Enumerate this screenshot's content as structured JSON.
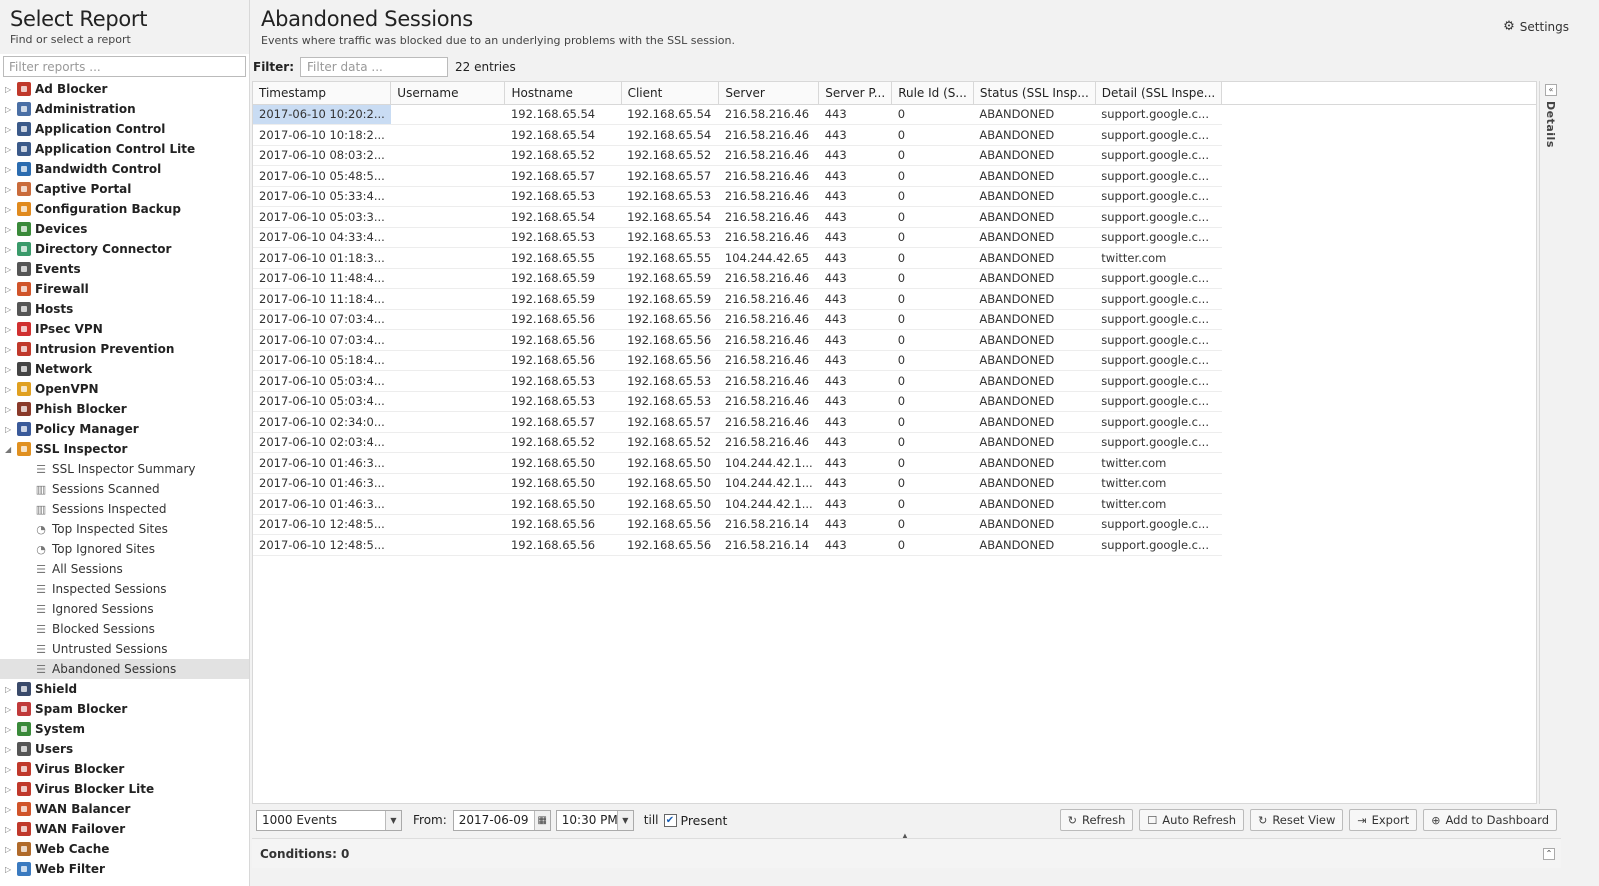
{
  "left_panel": {
    "title": "Select Report",
    "subtitle": "Find or select a report",
    "filter_placeholder": "Filter reports ...",
    "tree": [
      {
        "label": "Ad Blocker",
        "icon": "ad-blocker-icon",
        "color": "#c0392b"
      },
      {
        "label": "Administration",
        "icon": "administration-icon",
        "color": "#4a6fa5"
      },
      {
        "label": "Application Control",
        "icon": "application-control-icon",
        "color": "#3b5a8a"
      },
      {
        "label": "Application Control Lite",
        "icon": "application-control-lite-icon",
        "color": "#3b5a8a"
      },
      {
        "label": "Bandwidth Control",
        "icon": "bandwidth-control-icon",
        "color": "#2b6cb0"
      },
      {
        "label": "Captive Portal",
        "icon": "captive-portal-icon",
        "color": "#c96b3b"
      },
      {
        "label": "Configuration Backup",
        "icon": "configuration-backup-icon",
        "color": "#e08a1e"
      },
      {
        "label": "Devices",
        "icon": "devices-icon",
        "color": "#3a8a3a"
      },
      {
        "label": "Directory Connector",
        "icon": "directory-connector-icon",
        "color": "#3a9a6a"
      },
      {
        "label": "Events",
        "icon": "events-icon",
        "color": "#555555"
      },
      {
        "label": "Firewall",
        "icon": "firewall-icon",
        "color": "#d0542a"
      },
      {
        "label": "Hosts",
        "icon": "hosts-icon",
        "color": "#555555"
      },
      {
        "label": "IPsec VPN",
        "icon": "ipsec-vpn-icon",
        "color": "#d03030"
      },
      {
        "label": "Intrusion Prevention",
        "icon": "intrusion-prevention-icon",
        "color": "#c0392b"
      },
      {
        "label": "Network",
        "icon": "network-icon",
        "color": "#444444"
      },
      {
        "label": "OpenVPN",
        "icon": "openvpn-icon",
        "color": "#e0a020"
      },
      {
        "label": "Phish Blocker",
        "icon": "phish-blocker-icon",
        "color": "#8a3a2a"
      },
      {
        "label": "Policy Manager",
        "icon": "policy-manager-icon",
        "color": "#3a5a9a"
      },
      {
        "label": "SSL Inspector",
        "icon": "ssl-inspector-icon",
        "color": "#e09020",
        "expanded": true,
        "children": [
          {
            "label": "SSL Inspector Summary",
            "icon": "text-lines-icon",
            "glyph": "☰"
          },
          {
            "label": "Sessions Scanned",
            "icon": "bar-chart-icon",
            "glyph": "▥"
          },
          {
            "label": "Sessions Inspected",
            "icon": "bar-chart-icon",
            "glyph": "▥"
          },
          {
            "label": "Top Inspected Sites",
            "icon": "pie-chart-icon",
            "glyph": "◔"
          },
          {
            "label": "Top Ignored Sites",
            "icon": "pie-chart-icon",
            "glyph": "◔"
          },
          {
            "label": "All Sessions",
            "icon": "list-icon",
            "glyph": "☰"
          },
          {
            "label": "Inspected Sessions",
            "icon": "list-icon",
            "glyph": "☰"
          },
          {
            "label": "Ignored Sessions",
            "icon": "list-icon",
            "glyph": "☰"
          },
          {
            "label": "Blocked Sessions",
            "icon": "list-icon",
            "glyph": "☰"
          },
          {
            "label": "Untrusted Sessions",
            "icon": "list-icon",
            "glyph": "☰"
          },
          {
            "label": "Abandoned Sessions",
            "icon": "list-icon",
            "glyph": "☰",
            "selected": true
          }
        ]
      },
      {
        "label": "Shield",
        "icon": "shield-icon",
        "color": "#3a4a6a"
      },
      {
        "label": "Spam Blocker",
        "icon": "spam-blocker-icon",
        "color": "#c03a3a"
      },
      {
        "label": "System",
        "icon": "system-icon",
        "color": "#3a8a3a"
      },
      {
        "label": "Users",
        "icon": "users-icon",
        "color": "#555555"
      },
      {
        "label": "Virus Blocker",
        "icon": "virus-blocker-icon",
        "color": "#c0392b"
      },
      {
        "label": "Virus Blocker Lite",
        "icon": "virus-blocker-lite-icon",
        "color": "#c0392b"
      },
      {
        "label": "WAN Balancer",
        "icon": "wan-balancer-icon",
        "color": "#d0542a"
      },
      {
        "label": "WAN Failover",
        "icon": "wan-failover-icon",
        "color": "#c0392b"
      },
      {
        "label": "Web Cache",
        "icon": "web-cache-icon",
        "color": "#b06a2a"
      },
      {
        "label": "Web Filter",
        "icon": "web-filter-icon",
        "color": "#3a7ac0"
      }
    ]
  },
  "header": {
    "title": "Abandoned Sessions",
    "subtitle": "Events where traffic was blocked due to an underlying problems with the SSL session.",
    "settings_label": "Settings"
  },
  "filter": {
    "label": "Filter:",
    "placeholder": "Filter data ...",
    "entries": "22 entries"
  },
  "table": {
    "columns": [
      "Timestamp",
      "Username",
      "Hostname",
      "Client",
      "Server",
      "Server P...",
      "Rule Id (S...",
      "Status (SSL Insp...",
      "Detail (SSL Inspe..."
    ],
    "rows": [
      [
        "2017-06-10 10:20:2...",
        "",
        "192.168.65.54",
        "192.168.65.54",
        "216.58.216.46",
        "443",
        "0",
        "ABANDONED",
        "support.google.c..."
      ],
      [
        "2017-06-10 10:18:2...",
        "",
        "192.168.65.54",
        "192.168.65.54",
        "216.58.216.46",
        "443",
        "0",
        "ABANDONED",
        "support.google.c..."
      ],
      [
        "2017-06-10 08:03:2...",
        "",
        "192.168.65.52",
        "192.168.65.52",
        "216.58.216.46",
        "443",
        "0",
        "ABANDONED",
        "support.google.c..."
      ],
      [
        "2017-06-10 05:48:5...",
        "",
        "192.168.65.57",
        "192.168.65.57",
        "216.58.216.46",
        "443",
        "0",
        "ABANDONED",
        "support.google.c..."
      ],
      [
        "2017-06-10 05:33:4...",
        "",
        "192.168.65.53",
        "192.168.65.53",
        "216.58.216.46",
        "443",
        "0",
        "ABANDONED",
        "support.google.c..."
      ],
      [
        "2017-06-10 05:03:3...",
        "",
        "192.168.65.54",
        "192.168.65.54",
        "216.58.216.46",
        "443",
        "0",
        "ABANDONED",
        "support.google.c..."
      ],
      [
        "2017-06-10 04:33:4...",
        "",
        "192.168.65.53",
        "192.168.65.53",
        "216.58.216.46",
        "443",
        "0",
        "ABANDONED",
        "support.google.c..."
      ],
      [
        "2017-06-10 01:18:3...",
        "",
        "192.168.65.55",
        "192.168.65.55",
        "104.244.42.65",
        "443",
        "0",
        "ABANDONED",
        "twitter.com"
      ],
      [
        "2017-06-10 11:48:4...",
        "",
        "192.168.65.59",
        "192.168.65.59",
        "216.58.216.46",
        "443",
        "0",
        "ABANDONED",
        "support.google.c..."
      ],
      [
        "2017-06-10 11:18:4...",
        "",
        "192.168.65.59",
        "192.168.65.59",
        "216.58.216.46",
        "443",
        "0",
        "ABANDONED",
        "support.google.c..."
      ],
      [
        "2017-06-10 07:03:4...",
        "",
        "192.168.65.56",
        "192.168.65.56",
        "216.58.216.46",
        "443",
        "0",
        "ABANDONED",
        "support.google.c..."
      ],
      [
        "2017-06-10 07:03:4...",
        "",
        "192.168.65.56",
        "192.168.65.56",
        "216.58.216.46",
        "443",
        "0",
        "ABANDONED",
        "support.google.c..."
      ],
      [
        "2017-06-10 05:18:4...",
        "",
        "192.168.65.56",
        "192.168.65.56",
        "216.58.216.46",
        "443",
        "0",
        "ABANDONED",
        "support.google.c..."
      ],
      [
        "2017-06-10 05:03:4...",
        "",
        "192.168.65.53",
        "192.168.65.53",
        "216.58.216.46",
        "443",
        "0",
        "ABANDONED",
        "support.google.c..."
      ],
      [
        "2017-06-10 05:03:4...",
        "",
        "192.168.65.53",
        "192.168.65.53",
        "216.58.216.46",
        "443",
        "0",
        "ABANDONED",
        "support.google.c..."
      ],
      [
        "2017-06-10 02:34:0...",
        "",
        "192.168.65.57",
        "192.168.65.57",
        "216.58.216.46",
        "443",
        "0",
        "ABANDONED",
        "support.google.c..."
      ],
      [
        "2017-06-10 02:03:4...",
        "",
        "192.168.65.52",
        "192.168.65.52",
        "216.58.216.46",
        "443",
        "0",
        "ABANDONED",
        "support.google.c..."
      ],
      [
        "2017-06-10 01:46:3...",
        "",
        "192.168.65.50",
        "192.168.65.50",
        "104.244.42.1...",
        "443",
        "0",
        "ABANDONED",
        "twitter.com"
      ],
      [
        "2017-06-10 01:46:3...",
        "",
        "192.168.65.50",
        "192.168.65.50",
        "104.244.42.1...",
        "443",
        "0",
        "ABANDONED",
        "twitter.com"
      ],
      [
        "2017-06-10 01:46:3...",
        "",
        "192.168.65.50",
        "192.168.65.50",
        "104.244.42.1...",
        "443",
        "0",
        "ABANDONED",
        "twitter.com"
      ],
      [
        "2017-06-10 12:48:5...",
        "",
        "192.168.65.56",
        "192.168.65.56",
        "216.58.216.14",
        "443",
        "0",
        "ABANDONED",
        "support.google.c..."
      ],
      [
        "2017-06-10 12:48:5...",
        "",
        "192.168.65.56",
        "192.168.65.56",
        "216.58.216.14",
        "443",
        "0",
        "ABANDONED",
        "support.google.c..."
      ]
    ],
    "selected_row": 0
  },
  "details_panel": {
    "label": "Details"
  },
  "toolbar": {
    "events_limit": "1000 Events",
    "from_label": "From:",
    "from_date": "2017-06-09",
    "from_time": "10:30 PM",
    "till_label": "till",
    "present_checked": true,
    "present_label": "Present",
    "refresh_label": "Refresh",
    "auto_refresh_label": "Auto Refresh",
    "reset_view_label": "Reset View",
    "export_label": "Export",
    "add_dashboard_label": "Add to Dashboard"
  },
  "conditions": {
    "label": "Conditions: 0"
  }
}
